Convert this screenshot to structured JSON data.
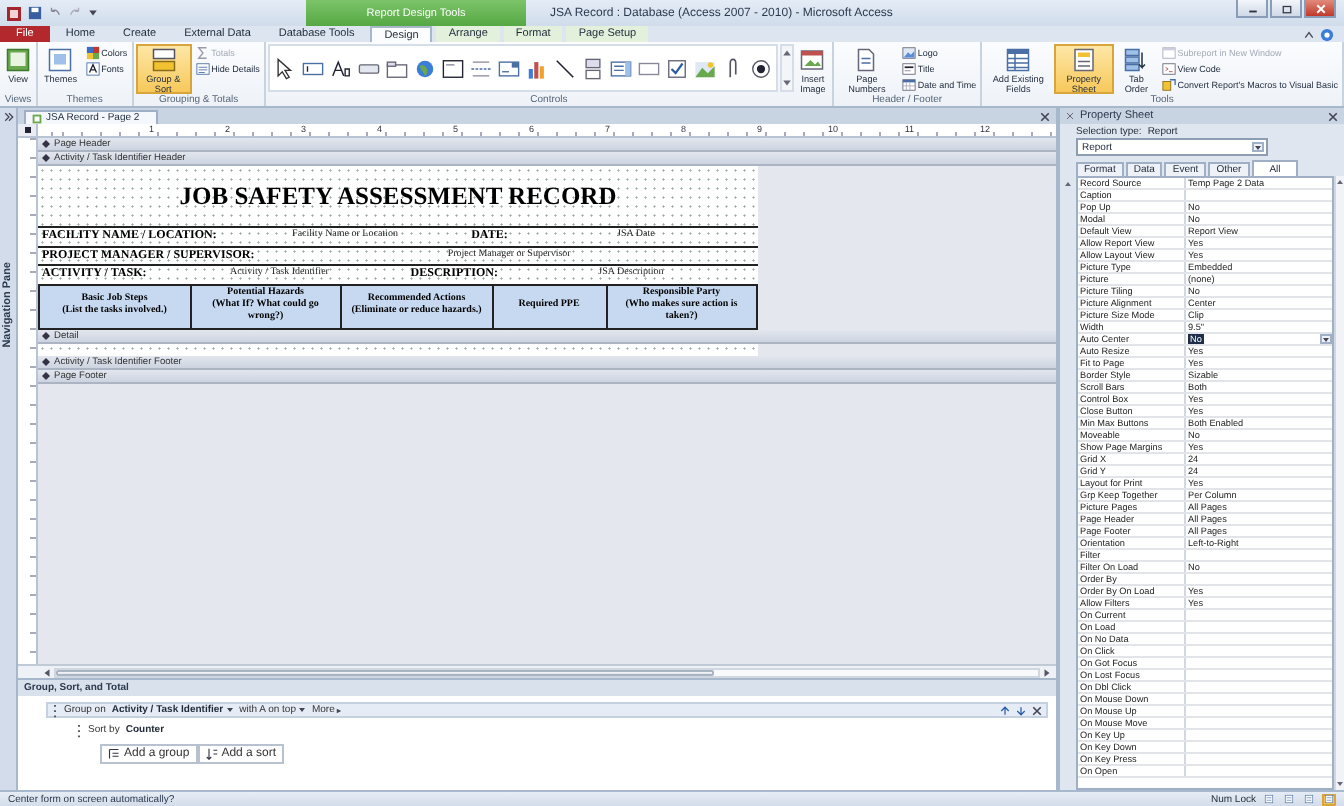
{
  "window": {
    "title": "JSA Record : Database (Access 2007 - 2010) - Microsoft Access",
    "context_tab": "Report Design Tools"
  },
  "ribbon_tabs": [
    {
      "label": "File",
      "kind": "file",
      "selected": false
    },
    {
      "label": "Home",
      "kind": "standard",
      "selected": false
    },
    {
      "label": "Create",
      "kind": "standard",
      "selected": false
    },
    {
      "label": "External Data",
      "kind": "standard",
      "selected": false
    },
    {
      "label": "Database Tools",
      "kind": "standard",
      "selected": false
    },
    {
      "label": "Design",
      "kind": "contextual",
      "selected": true
    },
    {
      "label": "Arrange",
      "kind": "contextual",
      "selected": false
    },
    {
      "label": "Format",
      "kind": "contextual",
      "selected": false
    },
    {
      "label": "Page Setup",
      "kind": "contextual",
      "selected": false
    }
  ],
  "ribbon_groups": [
    {
      "title": "Views",
      "items": [
        {
          "kind": "large",
          "label": "View",
          "selected": false
        }
      ]
    },
    {
      "title": "Themes",
      "items": [
        {
          "kind": "large",
          "label": "Themes",
          "selected": false
        },
        {
          "kind": "small",
          "label": "Colors",
          "disabled": false
        },
        {
          "kind": "small",
          "label": "Fonts",
          "disabled": false
        }
      ]
    },
    {
      "title": "Grouping & Totals",
      "items": [
        {
          "kind": "large",
          "label": "Group & Sort",
          "selected": true
        },
        {
          "kind": "small",
          "label": "Totals",
          "disabled": true
        },
        {
          "kind": "small",
          "label": "Hide Details",
          "disabled": false
        }
      ]
    },
    {
      "title": "Controls",
      "items": [
        {
          "kind": "gallery"
        },
        {
          "kind": "large",
          "label": "Insert Image",
          "selected": false
        }
      ]
    },
    {
      "title": "Header / Footer",
      "items": [
        {
          "kind": "large",
          "label": "Page Numbers",
          "selected": false
        },
        {
          "kind": "small",
          "label": "Logo",
          "disabled": false
        },
        {
          "kind": "small",
          "label": "Title",
          "disabled": false
        },
        {
          "kind": "small",
          "label": "Date and Time",
          "disabled": false
        }
      ]
    },
    {
      "title": "Tools",
      "items": [
        {
          "kind": "large",
          "label": "Add Existing Fields",
          "selected": false
        },
        {
          "kind": "large",
          "label": "Property Sheet",
          "selected": true
        },
        {
          "kind": "large",
          "label": "Tab Order",
          "selected": false
        },
        {
          "kind": "small",
          "label": "Subreport in New Window",
          "disabled": true
        },
        {
          "kind": "small",
          "label": "View Code",
          "disabled": false
        },
        {
          "kind": "small",
          "label": "Convert Report's Macros to Visual Basic",
          "disabled": false
        }
      ]
    }
  ],
  "navigation_pane": {
    "label": "Navigation Pane"
  },
  "document_tab": {
    "label": "JSA Record - Page 2"
  },
  "ruler_marks": [
    "1",
    "2",
    "3",
    "4",
    "5",
    "6",
    "7",
    "8",
    "9",
    "10",
    "11",
    "12"
  ],
  "sections_before": [
    {
      "label": "Page Header"
    },
    {
      "label": "Activity / Task Identifier Header"
    }
  ],
  "report": {
    "title": "JOB SAFETY ASSESSMENT RECORD",
    "info_rows": [
      [
        {
          "kind": "label",
          "text": "FACILITY NAME / LOCATION:"
        },
        {
          "kind": "field",
          "text": "Facility Name or Location"
        },
        {
          "kind": "label",
          "text": "DATE:"
        },
        {
          "kind": "field",
          "text": "JSA Date"
        }
      ],
      [
        {
          "kind": "label",
          "text": "PROJECT MANAGER / SUPERVISOR:"
        },
        {
          "kind": "field",
          "text": "Project Manager or Supervisor"
        }
      ],
      [
        {
          "kind": "label",
          "text": "ACTIVITY / TASK:"
        },
        {
          "kind": "field",
          "text": "Activity / Task Identifier"
        },
        {
          "kind": "label",
          "text": "DESCRIPTION:"
        },
        {
          "kind": "field",
          "text": "JSA Description"
        }
      ]
    ],
    "columns": [
      {
        "title": "Basic Job Steps",
        "note": "(List the tasks involved.)"
      },
      {
        "title": "Potential Hazards",
        "note": "(What If? What could go wrong?)"
      },
      {
        "title": "Recommended Actions",
        "note": "(Eliminate or reduce hazards.)"
      },
      {
        "title": "Required PPE"
      },
      {
        "title": "Responsible Party",
        "note": "(Who makes sure action is taken?)"
      }
    ]
  },
  "detail_section": {
    "label": "Detail"
  },
  "sections_after": [
    {
      "label": "Activity / Task Identifier Footer"
    },
    {
      "label": "Page Footer"
    }
  ],
  "group_pane": {
    "title": "Group, Sort, and Total",
    "levels": [
      {
        "kind": "group",
        "prefix": "Group on",
        "field": "Activity / Task Identifier",
        "order": "with A on top",
        "more": "More"
      },
      {
        "kind": "sort",
        "prefix": "Sort by",
        "field": "Counter"
      }
    ],
    "buttons": [
      "Add a group",
      "Add a sort"
    ]
  },
  "status_bar": {
    "message": "Center form on screen automatically?",
    "indicator": "Num Lock"
  },
  "property_sheet": {
    "title": "Property Sheet",
    "selection_label": "Selection type:",
    "selection_type": "Report",
    "object": "Report",
    "tabs": [
      {
        "label": "Format",
        "selected": false
      },
      {
        "label": "Data",
        "selected": false
      },
      {
        "label": "Event",
        "selected": false
      },
      {
        "label": "Other",
        "selected": false
      },
      {
        "label": "All",
        "selected": true
      }
    ],
    "rows": [
      {
        "name": "Record Source",
        "value": "Temp Page 2 Data",
        "selected": false
      },
      {
        "name": "Caption",
        "selected": false
      },
      {
        "name": "Pop Up",
        "value": "No",
        "selected": false
      },
      {
        "name": "Modal",
        "value": "No",
        "selected": false
      },
      {
        "name": "Default View",
        "value": "Report View",
        "selected": false
      },
      {
        "name": "Allow Report View",
        "value": "Yes",
        "selected": false
      },
      {
        "name": "Allow Layout View",
        "value": "Yes",
        "selected": false
      },
      {
        "name": "Picture Type",
        "value": "Embedded",
        "selected": false
      },
      {
        "name": "Picture",
        "value": "(none)",
        "selected": false
      },
      {
        "name": "Picture Tiling",
        "value": "No",
        "selected": false
      },
      {
        "name": "Picture Alignment",
        "value": "Center",
        "selected": false
      },
      {
        "name": "Picture Size Mode",
        "value": "Clip",
        "selected": false
      },
      {
        "name": "Width",
        "value": "9.5\"",
        "selected": false
      },
      {
        "name": "Auto Center",
        "value": "No",
        "selected": true
      },
      {
        "name": "Auto Resize",
        "value": "Yes",
        "selected": false
      },
      {
        "name": "Fit to Page",
        "value": "Yes",
        "selected": false
      },
      {
        "name": "Border Style",
        "value": "Sizable",
        "selected": false
      },
      {
        "name": "Scroll Bars",
        "value": "Both",
        "selected": false
      },
      {
        "name": "Control Box",
        "value": "Yes",
        "selected": false
      },
      {
        "name": "Close Button",
        "value": "Yes",
        "selected": false
      },
      {
        "name": "Min Max Buttons",
        "value": "Both Enabled",
        "selected": false
      },
      {
        "name": "Moveable",
        "value": "No",
        "selected": false
      },
      {
        "name": "Show Page Margins",
        "value": "Yes",
        "selected": false
      },
      {
        "name": "Grid X",
        "value": "24",
        "selected": false
      },
      {
        "name": "Grid Y",
        "value": "24",
        "selected": false
      },
      {
        "name": "Layout for Print",
        "value": "Yes",
        "selected": false
      },
      {
        "name": "Grp Keep Together",
        "value": "Per Column",
        "selected": false
      },
      {
        "name": "Picture Pages",
        "value": "All Pages",
        "selected": false
      },
      {
        "name": "Page Header",
        "value": "All Pages",
        "selected": false
      },
      {
        "name": "Page Footer",
        "value": "All Pages",
        "selected": false
      },
      {
        "name": "Orientation",
        "value": "Left-to-Right",
        "selected": false
      },
      {
        "name": "Filter",
        "selected": false
      },
      {
        "name": "Filter On Load",
        "value": "No",
        "selected": false
      },
      {
        "name": "Order By",
        "selected": false
      },
      {
        "name": "Order By On Load",
        "value": "Yes",
        "selected": false
      },
      {
        "name": "Allow Filters",
        "value": "Yes",
        "selected": false
      },
      {
        "name": "On Current",
        "selected": false
      },
      {
        "name": "On Load",
        "selected": false
      },
      {
        "name": "On No Data",
        "selected": false
      },
      {
        "name": "On Click",
        "selected": false
      },
      {
        "name": "On Got Focus",
        "selected": false
      },
      {
        "name": "On Lost Focus",
        "selected": false
      },
      {
        "name": "On Dbl Click",
        "selected": false
      },
      {
        "name": "On Mouse Down",
        "selected": false
      },
      {
        "name": "On Mouse Up",
        "selected": false
      },
      {
        "name": "On Mouse Move",
        "selected": false
      },
      {
        "name": "On Key Up",
        "selected": false
      },
      {
        "name": "On Key Down",
        "selected": false
      },
      {
        "name": "On Key Press",
        "selected": false
      },
      {
        "name": "On Open",
        "selected": false
      }
    ]
  }
}
